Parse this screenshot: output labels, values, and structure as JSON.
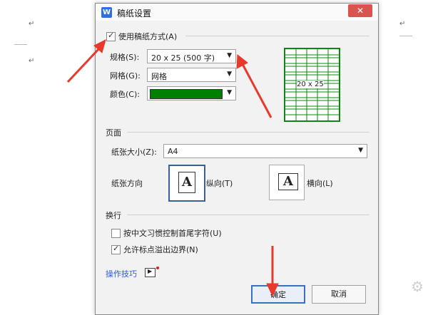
{
  "dialog": {
    "title": "稿纸设置",
    "close_label": "✕"
  },
  "grid_settings": {
    "use_grid_label": "使用稿纸方式(A)",
    "use_grid_checked": true,
    "spec_label": "规格(S):",
    "spec_value": "20 x 25 (500 字)",
    "grid_label": "网格(G):",
    "grid_value": "网格",
    "color_label": "颜色(C):",
    "color_value": "#008000",
    "preview_text": "20 x 25"
  },
  "page": {
    "section_label": "页面",
    "paper_size_label": "纸张大小(Z):",
    "paper_size_value": "A4",
    "orientation_label": "纸张方向",
    "portrait_label": "纵向(T)",
    "landscape_label": "横向(L)",
    "orientation_glyph": "A",
    "selected": "portrait"
  },
  "line_break": {
    "section_label": "换行",
    "chinese_rule_label": "按中文习惯控制首尾字符(U)",
    "chinese_rule_checked": false,
    "overflow_label": "允许标点溢出边界(N)",
    "overflow_checked": true
  },
  "footer": {
    "tips_label": "操作技巧",
    "ok_label": "确定",
    "cancel_label": "取消"
  },
  "background": {
    "para_mark": "↵"
  },
  "colors": {
    "annotation_arrow": "#e8392a",
    "accent": "#2f6fde"
  }
}
